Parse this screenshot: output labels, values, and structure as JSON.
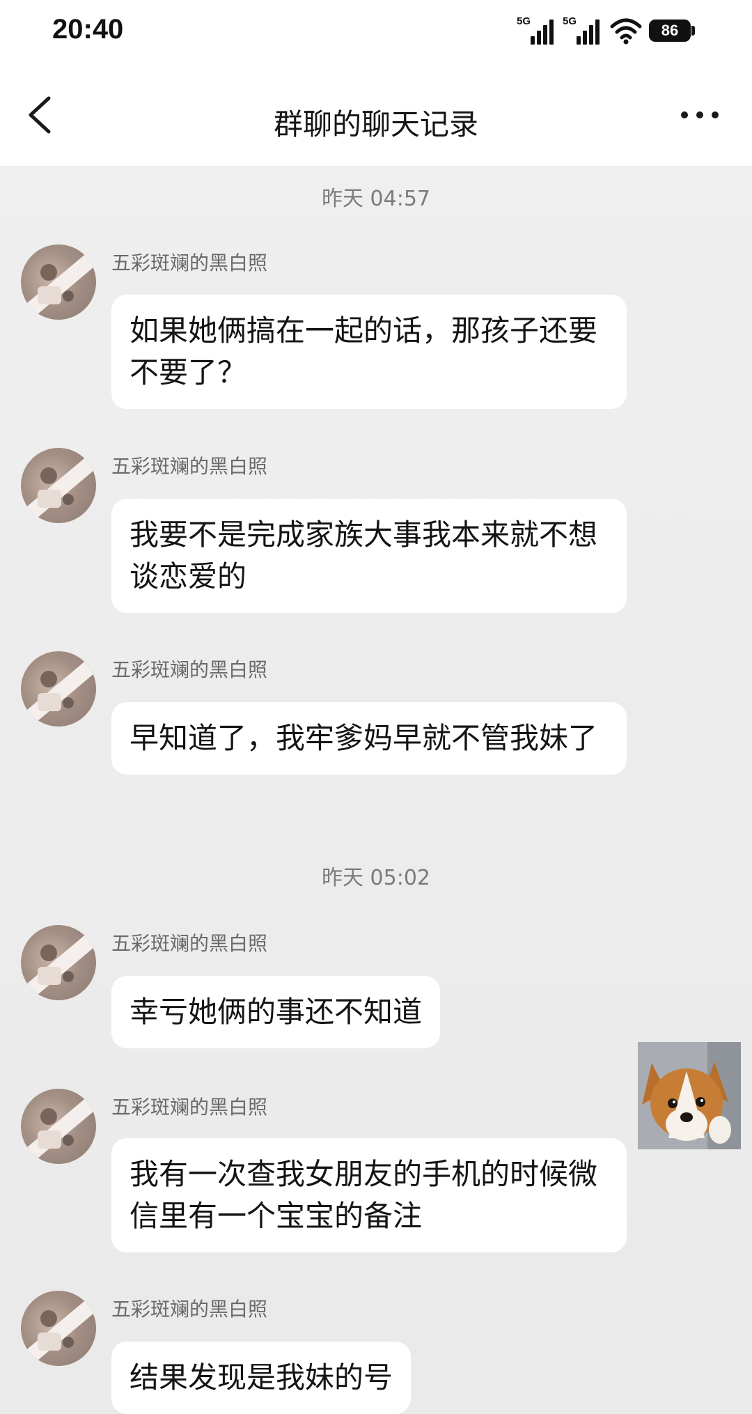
{
  "status_bar": {
    "time": "20:40",
    "signal1_label": "5G",
    "signal2_label": "5G",
    "battery": "86"
  },
  "nav": {
    "title": "群聊的聊天记录",
    "back_icon": "chevron-left-icon",
    "more_icon": "more-horizontal-icon"
  },
  "chat": {
    "timestamps": [
      "昨天 04:57",
      "昨天 05:02"
    ],
    "sender_name": "五彩斑斓的黑白照",
    "messages": [
      {
        "sender": "五彩斑斓的黑白照",
        "text": "如果她俩搞在一起的话，那孩子还要不要了？"
      },
      {
        "sender": "五彩斑斓的黑白照",
        "text": "我要不是完成家族大事我本来就不想谈恋爱的"
      },
      {
        "sender": "五彩斑斓的黑白照",
        "text": "早知道了，我牢爹妈早就不管我妹了"
      },
      {
        "sender": "五彩斑斓的黑白照",
        "text": "幸亏她俩的事还不知道"
      },
      {
        "sender": "五彩斑斓的黑白照",
        "text": "我有一次查我女朋友的手机的时候微信里有一个宝宝的备注"
      },
      {
        "sender": "五彩斑斓的黑白照",
        "text": "结果发现是我妹的号"
      }
    ],
    "sticker_icon": "puppy-sticker-icon"
  }
}
